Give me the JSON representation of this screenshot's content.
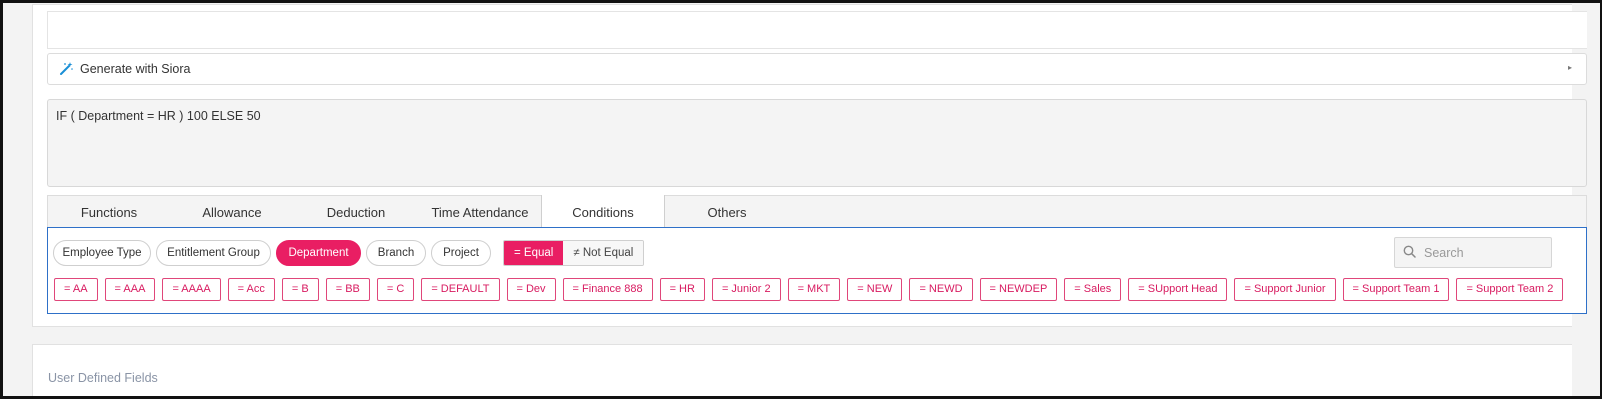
{
  "siora": {
    "label": "Generate with Siora",
    "chevron": "▸"
  },
  "formula": {
    "text": "IF ( Department = HR ) 100 ELSE 50"
  },
  "tabs": [
    {
      "label": "Functions"
    },
    {
      "label": "Allowance"
    },
    {
      "label": "Deduction"
    },
    {
      "label": "Time Attendance"
    },
    {
      "label": "Conditions"
    },
    {
      "label": "Others"
    }
  ],
  "active_tab": "Conditions",
  "filters": [
    {
      "label": "Employee Type"
    },
    {
      "label": "Entitlement Group"
    },
    {
      "label": "Department"
    },
    {
      "label": "Branch"
    },
    {
      "label": "Project"
    }
  ],
  "active_filter": "Department",
  "operators": {
    "equal": "= Equal",
    "not_equal": "≠ Not Equal"
  },
  "search": {
    "placeholder": "Search"
  },
  "values": [
    "= AA",
    "= AAA",
    "= AAAA",
    "= Acc",
    "= B",
    "= BB",
    "= C",
    "= DEFAULT",
    "= Dev",
    "= Finance 888",
    "= HR",
    "= Junior 2",
    "= MKT",
    "= NEW",
    "= NEWD",
    "= NEWDEP",
    "= Sales",
    "= SUpport Head",
    "= Support Junior",
    "= Support Team 1",
    "= Support Team 2"
  ],
  "user_defined_fields": {
    "title": "User Defined Fields"
  },
  "colors": {
    "accent": "#e91e63",
    "panel_border": "#2e70c8",
    "wand": "#1a8fd6"
  },
  "icons": {
    "wand": "magic-wand-icon",
    "search": "search-icon",
    "chevron": "chevron-right-icon"
  }
}
